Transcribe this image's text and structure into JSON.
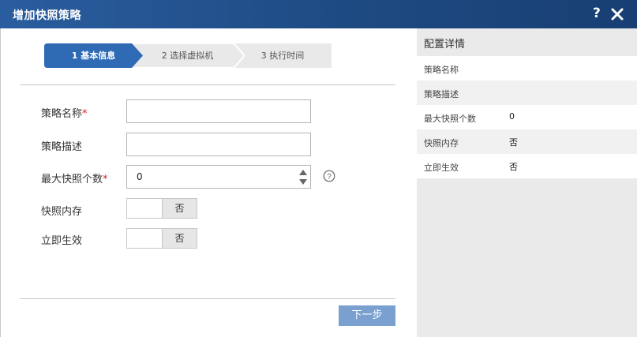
{
  "dialog": {
    "title": "增加快照策略",
    "help_label": "?"
  },
  "steps": [
    {
      "label": "1 基本信息",
      "active": true
    },
    {
      "label": "2 选择虚拟机",
      "active": false
    },
    {
      "label": "3 执行时间",
      "active": false
    }
  ],
  "form": {
    "name_label": "策略名称",
    "desc_label": "策略描述",
    "max_label": "最大快照个数",
    "memory_label": "快照内存",
    "effective_label": "立即生效",
    "required_mark": "*",
    "name_value": "",
    "desc_value": "",
    "max_value": "0",
    "memory_value": "否",
    "effective_value": "否"
  },
  "buttons": {
    "next": "下一步"
  },
  "details": {
    "title": "配置详情",
    "rows": [
      {
        "key": "策略名称",
        "value": ""
      },
      {
        "key": "策略描述",
        "value": ""
      },
      {
        "key": "最大快照个数",
        "value": "0"
      },
      {
        "key": "快照内存",
        "value": "否"
      },
      {
        "key": "立即生效",
        "value": "否"
      }
    ]
  },
  "colors": {
    "titlebar": "#1e4a82",
    "step_active": "#2f6bb5",
    "step_inactive": "#e9e9e9",
    "next_button": "#7aa0cf",
    "required": "#e02020"
  }
}
